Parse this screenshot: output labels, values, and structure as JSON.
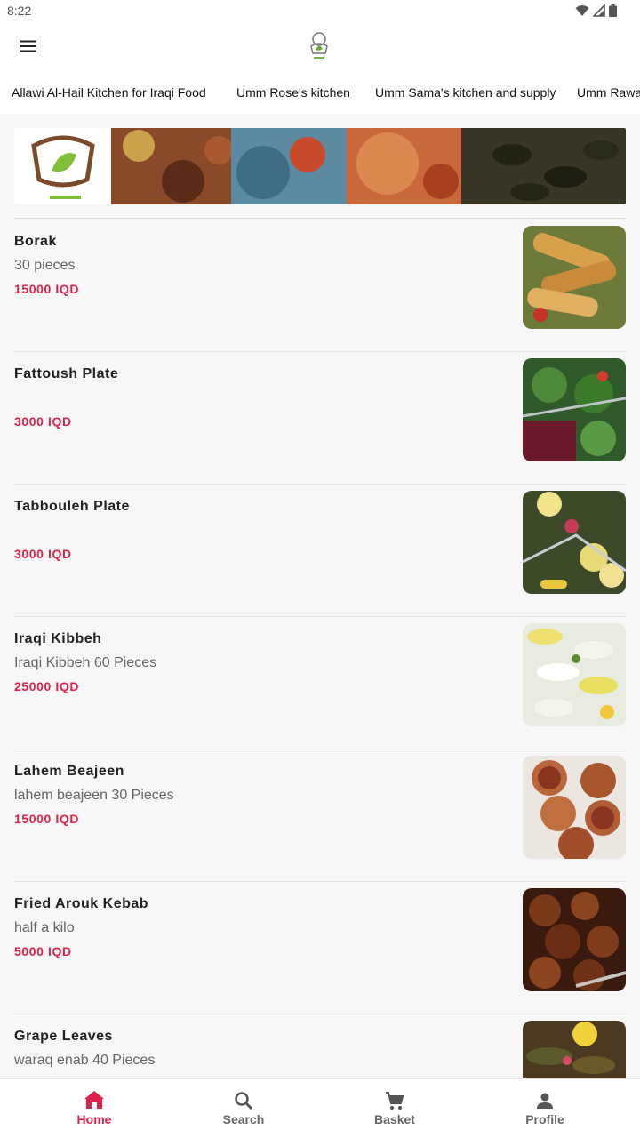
{
  "status": {
    "time": "8:22"
  },
  "header": {
    "logo": "kitchen-logo"
  },
  "tabs": [
    {
      "label": "Allawi Al-Hail Kitchen for Iraqi Food",
      "active": true
    },
    {
      "label": "Umm Rose's kitchen",
      "active": false
    },
    {
      "label": "Umm Sama's kitchen and supply",
      "active": false
    },
    {
      "label": "Umm Rawa",
      "active": false
    }
  ],
  "colors": {
    "accent": "#e0224a",
    "background": "#f7f7f7"
  },
  "menu": [
    {
      "name": "Borak",
      "desc": "30 pieces",
      "price": "15000 IQD"
    },
    {
      "name": "Fattoush Plate",
      "desc": "",
      "price": "3000 IQD"
    },
    {
      "name": "Tabbouleh Plate",
      "desc": "",
      "price": "3000 IQD"
    },
    {
      "name": "Iraqi Kibbeh",
      "desc": "Iraqi Kibbeh 60 Pieces",
      "price": "25000 IQD"
    },
    {
      "name": "Lahem Beajeen",
      "desc": "lahem beajeen 30 Pieces",
      "price": "15000 IQD"
    },
    {
      "name": "Fried Arouk Kebab",
      "desc": "half a kilo",
      "price": "5000 IQD"
    },
    {
      "name": "Grape Leaves",
      "desc": "waraq enab 40 Pieces",
      "price": ""
    }
  ],
  "nav": [
    {
      "label": "Home",
      "icon": "home-icon",
      "active": true
    },
    {
      "label": "Search",
      "icon": "search-icon",
      "active": false
    },
    {
      "label": "Basket",
      "icon": "cart-icon",
      "active": false
    },
    {
      "label": "Profile",
      "icon": "person-icon",
      "active": false
    }
  ]
}
